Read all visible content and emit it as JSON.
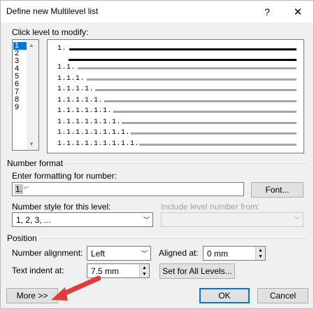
{
  "title": "Define new Multilevel list",
  "titlebar": {
    "help": "?",
    "close": "✕"
  },
  "levels": {
    "label": "Click level to modify:",
    "items": [
      "1",
      "2",
      "3",
      "4",
      "5",
      "6",
      "7",
      "8",
      "9"
    ],
    "selected_index": 0
  },
  "preview": {
    "numbers": [
      "1.",
      "1.1.",
      "1.1.1.",
      "1.1.1.1.",
      "1.1.1.1.1.",
      "1.1.1.1.1.1.",
      "1.1.1.1.1.1.1.",
      "1.1.1.1.1.1.1.1.",
      "1.1.1.1.1.1.1.1.1."
    ]
  },
  "number_format": {
    "section_title": "Number format",
    "enter_formatting_label": "Enter formatting for number:",
    "formatting_value": "1.",
    "paragraph_mark": "↵",
    "font_button": "Font...",
    "number_style_label": "Number style for this level:",
    "number_style_value": "1, 2, 3, ...",
    "include_level_label": "Include level number from:",
    "include_level_value": ""
  },
  "position": {
    "section_title": "Position",
    "number_alignment_label": "Number alignment:",
    "number_alignment_value": "Left",
    "aligned_at_label": "Aligned at:",
    "aligned_at_value": "0 mm",
    "text_indent_label": "Text indent at:",
    "text_indent_value": "7.5 mm",
    "set_all_levels_button": "Set for All Levels..."
  },
  "footer": {
    "more_button": "More >>",
    "ok_button": "OK",
    "cancel_button": "Cancel"
  },
  "colors": {
    "selection": "#0078d7",
    "annotation_arrow": "#e03c3c"
  }
}
